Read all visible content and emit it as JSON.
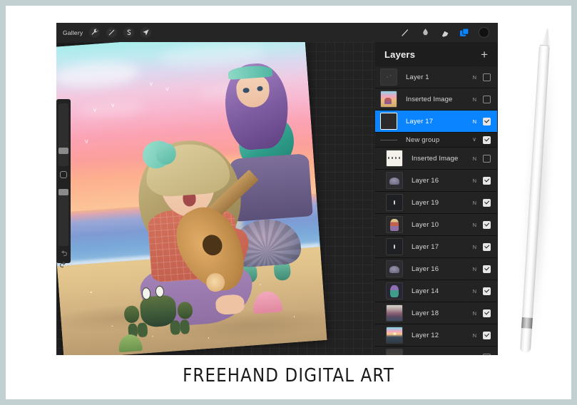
{
  "frame": {
    "border_color": "#c2d0d2",
    "page_color": "#ffffff"
  },
  "caption": {
    "text": "FREEHAND DIGITAL ART"
  },
  "app": {
    "accent_color": "#0a84ff",
    "background_color": "#1b1b1b"
  },
  "toolbar": {
    "gallery_label": "Gallery",
    "left_tools": [
      {
        "name": "adjustments-wrench-icon",
        "label": "Actions"
      },
      {
        "name": "magic-wand-icon",
        "label": "Adjustments"
      },
      {
        "name": "selection-s-icon",
        "label": "Selection"
      },
      {
        "name": "transform-arrow-icon",
        "label": "Transform"
      }
    ],
    "right_tools": [
      {
        "name": "brush-icon",
        "label": "Paint"
      },
      {
        "name": "smudge-icon",
        "label": "Smudge"
      },
      {
        "name": "eraser-icon",
        "label": "Erase"
      },
      {
        "name": "layers-icon",
        "label": "Layers",
        "active": true
      },
      {
        "name": "color-swatch-icon",
        "label": "Color",
        "color": "#111111"
      }
    ]
  },
  "sidebar": {
    "brush_size_label": "Brush size",
    "opacity_label": "Opacity",
    "modify_label": "Modify",
    "undo_label": "Undo",
    "redo_label": "Redo"
  },
  "layers_panel": {
    "title": "Layers",
    "add_label": "+",
    "blend_mode_short": "N",
    "group_chevron": "∨",
    "rows": [
      {
        "name": "Layer 1",
        "mode": "N",
        "checked": false,
        "selected": false,
        "group": false,
        "indent": false,
        "thumb": "th-sketch"
      },
      {
        "name": "Inserted Image",
        "mode": "N",
        "checked": false,
        "selected": false,
        "group": false,
        "indent": false,
        "thumb": "th-beach"
      },
      {
        "name": "Layer 17",
        "mode": "N",
        "checked": true,
        "selected": true,
        "group": false,
        "indent": false,
        "thumb": "th-dark"
      },
      {
        "name": "New group",
        "mode": "",
        "checked": true,
        "selected": false,
        "group": true,
        "indent": false,
        "thumb": "line"
      },
      {
        "name": "Inserted Image",
        "mode": "N",
        "checked": false,
        "selected": false,
        "group": false,
        "indent": true,
        "thumb": "th-wave"
      },
      {
        "name": "Layer 16",
        "mode": "N",
        "checked": true,
        "selected": false,
        "group": false,
        "indent": true,
        "thumb": "th-turtle"
      },
      {
        "name": "Layer 19",
        "mode": "N",
        "checked": true,
        "selected": false,
        "group": false,
        "indent": true,
        "thumb": "th-dot"
      },
      {
        "name": "Layer 10",
        "mode": "N",
        "checked": true,
        "selected": false,
        "group": false,
        "indent": true,
        "thumb": "th-girl"
      },
      {
        "name": "Layer 17",
        "mode": "N",
        "checked": true,
        "selected": false,
        "group": false,
        "indent": true,
        "thumb": "th-dot"
      },
      {
        "name": "Layer 16",
        "mode": "N",
        "checked": true,
        "selected": false,
        "group": false,
        "indent": true,
        "thumb": "th-turtle"
      },
      {
        "name": "Layer 14",
        "mode": "N",
        "checked": true,
        "selected": false,
        "group": false,
        "indent": true,
        "thumb": "th-mermaid"
      },
      {
        "name": "Layer 18",
        "mode": "N",
        "checked": true,
        "selected": false,
        "group": false,
        "indent": true,
        "thumb": "th-horizon"
      },
      {
        "name": "Layer 12",
        "mode": "N",
        "checked": true,
        "selected": false,
        "group": false,
        "indent": true,
        "thumb": "th-sunset"
      },
      {
        "name": "",
        "mode": "",
        "checked": false,
        "selected": false,
        "group": false,
        "indent": true,
        "thumb": "th-partial"
      }
    ]
  },
  "artwork": {
    "description": "Girl playing guitar on beach at sunset with mermaid, turtle, crab and shells",
    "rotation_deg": -4.2
  },
  "stylus": {
    "name": "apple-pencil",
    "body_color": "#ffffff",
    "band_color": "#b8b8b8"
  }
}
